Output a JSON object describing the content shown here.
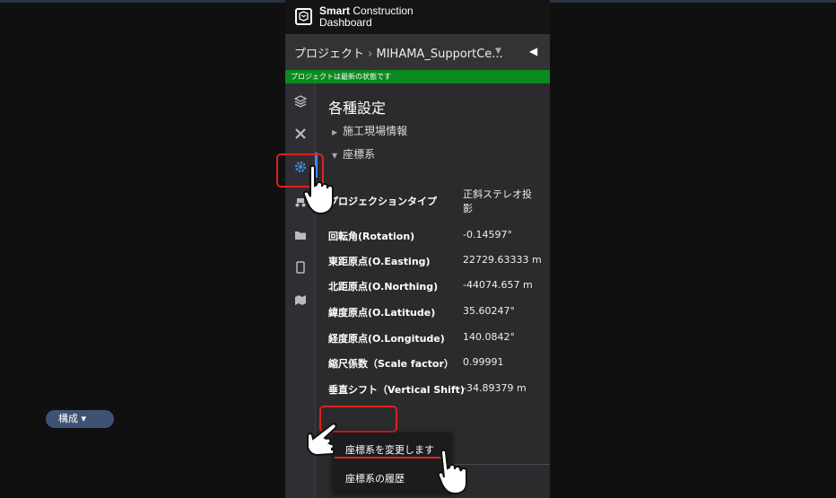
{
  "app": {
    "brand_line1": "Smart",
    "brand_line1_rest": " Construction",
    "brand_line2": "Dashboard"
  },
  "breadcrumb": {
    "root": "プロジェクト",
    "sep": "›",
    "project": "MIHAMA_SupportCe...",
    "dropdown_icon": "chevron-down-icon",
    "collapse_icon": "caret-left-icon"
  },
  "status": {
    "text": "プロジェクトは最新の状態です",
    "color": "#0a8a1f"
  },
  "rail": {
    "icons": [
      "layers-icon",
      "tools-icon",
      "settings-icon",
      "machine-icon",
      "folder-icon",
      "tablet-icon",
      "map-icon"
    ],
    "active": "settings-icon",
    "accent": "#3b8be8"
  },
  "settings": {
    "title": "各種設定",
    "sections": [
      {
        "label": "施工現場情報",
        "expanded": false
      },
      {
        "label": "座標系",
        "expanded": true
      }
    ],
    "coordinate_rows": [
      {
        "label": "プロジェクションタイプ",
        "value_line1": "正斜ステレオ投",
        "value_line2": "影"
      },
      {
        "label": "回転角(Rotation)",
        "value": "-0.14597°"
      },
      {
        "label": "東距原点(O.Easting)",
        "value": "22729.63333 m"
      },
      {
        "label": "北距原点(O.Northing)",
        "value": "-44074.657 m"
      },
      {
        "label": "緯度原点(O.Latitude)",
        "value": "35.60247°"
      },
      {
        "label": "経度原点(O.Longitude)",
        "value": "140.0842°"
      },
      {
        "label": "縮尺係数（Scale factor）",
        "value": "0.99991"
      },
      {
        "label": "垂直シフト（Vertical Shift)",
        "value": "-34.89379 m"
      }
    ],
    "config_button": "構成 ▾",
    "menu_items": [
      "座標系を変更します",
      "座標系の履歴"
    ]
  },
  "annotation_color": "#e0201c"
}
